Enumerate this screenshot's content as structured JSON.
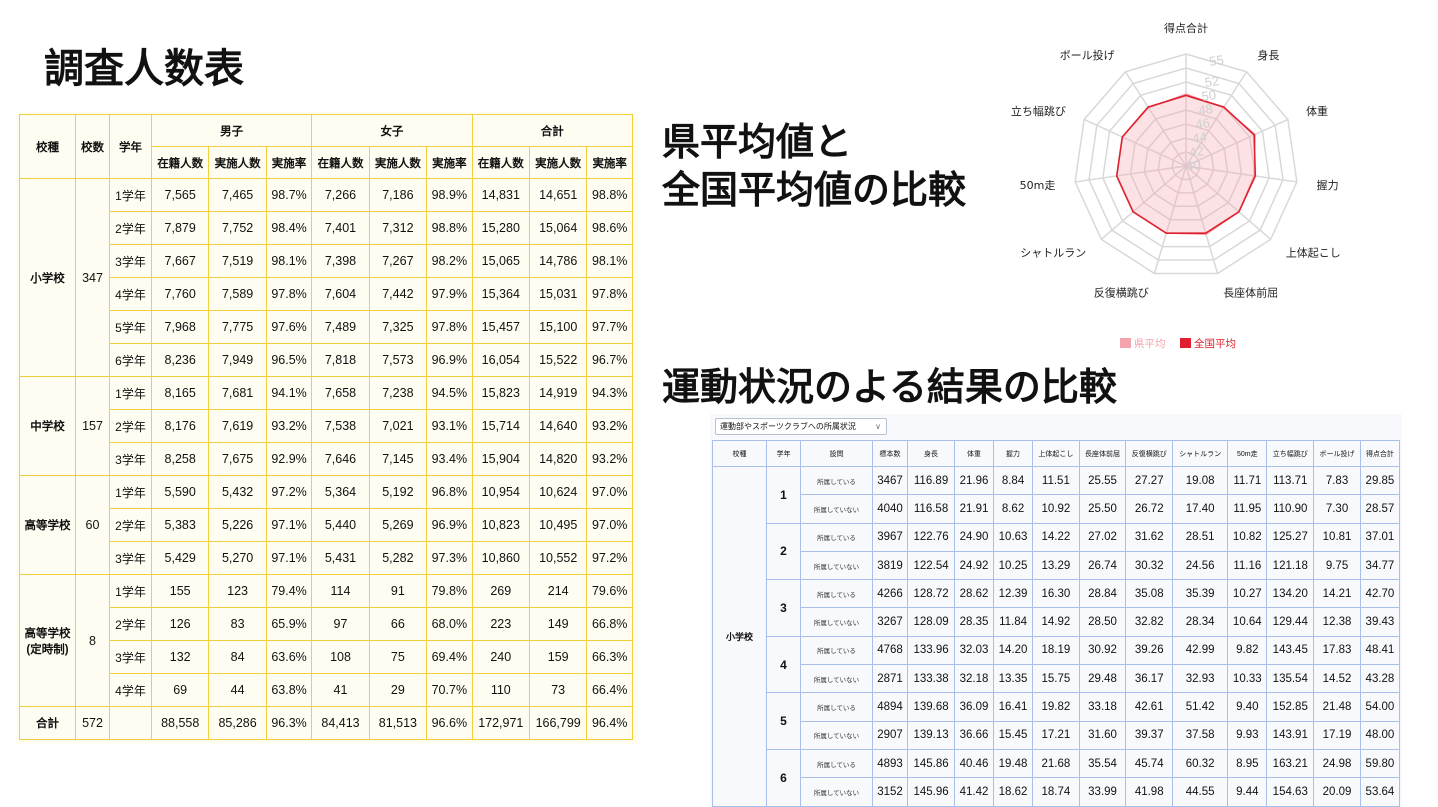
{
  "titles": {
    "main": "調査人数表",
    "compare_line1": "県平均値と",
    "compare_line2": "全国平均値の比較",
    "sports": "運動状況のよる結果の比較"
  },
  "survey": {
    "headers": {
      "school_type": "校種",
      "school_count": "校数",
      "grade": "学年",
      "male": "男子",
      "female": "女子",
      "total": "合計",
      "enrolled": "在籍人数",
      "conducted": "実施人数",
      "rate": "実施率"
    },
    "groups": [
      {
        "name": [
          "小学校"
        ],
        "count": "347",
        "rows": [
          [
            "1学年",
            "7,565",
            "7,465",
            "98.7%",
            "7,266",
            "7,186",
            "98.9%",
            "14,831",
            "14,651",
            "98.8%"
          ],
          [
            "2学年",
            "7,879",
            "7,752",
            "98.4%",
            "7,401",
            "7,312",
            "98.8%",
            "15,280",
            "15,064",
            "98.6%"
          ],
          [
            "3学年",
            "7,667",
            "7,519",
            "98.1%",
            "7,398",
            "7,267",
            "98.2%",
            "15,065",
            "14,786",
            "98.1%"
          ],
          [
            "4学年",
            "7,760",
            "7,589",
            "97.8%",
            "7,604",
            "7,442",
            "97.9%",
            "15,364",
            "15,031",
            "97.8%"
          ],
          [
            "5学年",
            "7,968",
            "7,775",
            "97.6%",
            "7,489",
            "7,325",
            "97.8%",
            "15,457",
            "15,100",
            "97.7%"
          ],
          [
            "6学年",
            "8,236",
            "7,949",
            "96.5%",
            "7,818",
            "7,573",
            "96.9%",
            "16,054",
            "15,522",
            "96.7%"
          ]
        ]
      },
      {
        "name": [
          "中学校"
        ],
        "count": "157",
        "rows": [
          [
            "1学年",
            "8,165",
            "7,681",
            "94.1%",
            "7,658",
            "7,238",
            "94.5%",
            "15,823",
            "14,919",
            "94.3%"
          ],
          [
            "2学年",
            "8,176",
            "7,619",
            "93.2%",
            "7,538",
            "7,021",
            "93.1%",
            "15,714",
            "14,640",
            "93.2%"
          ],
          [
            "3学年",
            "8,258",
            "7,675",
            "92.9%",
            "7,646",
            "7,145",
            "93.4%",
            "15,904",
            "14,820",
            "93.2%"
          ]
        ]
      },
      {
        "name": [
          "高等学校"
        ],
        "count": "60",
        "rows": [
          [
            "1学年",
            "5,590",
            "5,432",
            "97.2%",
            "5,364",
            "5,192",
            "96.8%",
            "10,954",
            "10,624",
            "97.0%"
          ],
          [
            "2学年",
            "5,383",
            "5,226",
            "97.1%",
            "5,440",
            "5,269",
            "96.9%",
            "10,823",
            "10,495",
            "97.0%"
          ],
          [
            "3学年",
            "5,429",
            "5,270",
            "97.1%",
            "5,431",
            "5,282",
            "97.3%",
            "10,860",
            "10,552",
            "97.2%"
          ]
        ]
      },
      {
        "name": [
          "高等学校",
          "(定時制)"
        ],
        "count": "8",
        "rows": [
          [
            "1学年",
            "155",
            "123",
            "79.4%",
            "114",
            "91",
            "79.8%",
            "269",
            "214",
            "79.6%"
          ],
          [
            "2学年",
            "126",
            "83",
            "65.9%",
            "97",
            "66",
            "68.0%",
            "223",
            "149",
            "66.8%"
          ],
          [
            "3学年",
            "132",
            "84",
            "63.6%",
            "108",
            "75",
            "69.4%",
            "240",
            "159",
            "66.3%"
          ],
          [
            "4学年",
            "69",
            "44",
            "63.8%",
            "41",
            "29",
            "70.7%",
            "110",
            "73",
            "66.4%"
          ]
        ]
      }
    ],
    "total_row": [
      "合計",
      "572",
      "",
      "88,558",
      "85,286",
      "96.3%",
      "84,413",
      "81,513",
      "96.6%",
      "172,971",
      "166,799",
      "96.4%"
    ]
  },
  "sports": {
    "select_label": "運動部やスポーツクラブへの所属状況",
    "headers": [
      "校種",
      "学年",
      "設問",
      "標本数",
      "身長",
      "体重",
      "握力",
      "上体起こし",
      "長座体前屈",
      "反復横跳び",
      "シャトルラン",
      "50m走",
      "立ち幅跳び",
      "ボール投げ",
      "得点合計"
    ],
    "school": "小学校",
    "grades": [
      {
        "grade": "1",
        "rows": [
          [
            "所属している",
            "3467",
            "116.89",
            "21.96",
            "8.84",
            "11.51",
            "25.55",
            "27.27",
            "19.08",
            "11.71",
            "113.71",
            "7.83",
            "29.85"
          ],
          [
            "所属していない",
            "4040",
            "116.58",
            "21.91",
            "8.62",
            "10.92",
            "25.50",
            "26.72",
            "17.40",
            "11.95",
            "110.90",
            "7.30",
            "28.57"
          ]
        ]
      },
      {
        "grade": "2",
        "rows": [
          [
            "所属している",
            "3967",
            "122.76",
            "24.90",
            "10.63",
            "14.22",
            "27.02",
            "31.62",
            "28.51",
            "10.82",
            "125.27",
            "10.81",
            "37.01"
          ],
          [
            "所属していない",
            "3819",
            "122.54",
            "24.92",
            "10.25",
            "13.29",
            "26.74",
            "30.32",
            "24.56",
            "11.16",
            "121.18",
            "9.75",
            "34.77"
          ]
        ]
      },
      {
        "grade": "3",
        "rows": [
          [
            "所属している",
            "4266",
            "128.72",
            "28.62",
            "12.39",
            "16.30",
            "28.84",
            "35.08",
            "35.39",
            "10.27",
            "134.20",
            "14.21",
            "42.70"
          ],
          [
            "所属していない",
            "3267",
            "128.09",
            "28.35",
            "11.84",
            "14.92",
            "28.50",
            "32.82",
            "28.34",
            "10.64",
            "129.44",
            "12.38",
            "39.43"
          ]
        ]
      },
      {
        "grade": "4",
        "rows": [
          [
            "所属している",
            "4768",
            "133.96",
            "32.03",
            "14.20",
            "18.19",
            "30.92",
            "39.26",
            "42.99",
            "9.82",
            "143.45",
            "17.83",
            "48.41"
          ],
          [
            "所属していない",
            "2871",
            "133.38",
            "32.18",
            "13.35",
            "15.75",
            "29.48",
            "36.17",
            "32.93",
            "10.33",
            "135.54",
            "14.52",
            "43.28"
          ]
        ]
      },
      {
        "grade": "5",
        "rows": [
          [
            "所属している",
            "4894",
            "139.68",
            "36.09",
            "16.41",
            "19.82",
            "33.18",
            "42.61",
            "51.42",
            "9.40",
            "152.85",
            "21.48",
            "54.00"
          ],
          [
            "所属していない",
            "2907",
            "139.13",
            "36.66",
            "15.45",
            "17.21",
            "31.60",
            "39.37",
            "37.58",
            "9.93",
            "143.91",
            "17.19",
            "48.00"
          ]
        ]
      },
      {
        "grade": "6",
        "rows": [
          [
            "所属している",
            "4893",
            "145.86",
            "40.46",
            "19.48",
            "21.68",
            "35.54",
            "45.74",
            "60.32",
            "8.95",
            "163.21",
            "24.98",
            "59.80"
          ],
          [
            "所属していない",
            "3152",
            "145.96",
            "41.42",
            "18.62",
            "18.74",
            "33.99",
            "41.98",
            "44.55",
            "9.44",
            "154.63",
            "20.09",
            "53.64"
          ]
        ]
      }
    ]
  },
  "chart_data": {
    "type": "radar",
    "axes": [
      "得点合計",
      "身長",
      "体重",
      "握力",
      "上体起こし",
      "長座体前屈",
      "反復横跳び",
      "シャトルラン",
      "50m走",
      "立ち幅跳び",
      "ボール投げ"
    ],
    "rmin": 40,
    "rmax": 56,
    "tick_labels": [
      "40",
      "42",
      "44",
      "46",
      "48",
      "50",
      "52",
      "55"
    ],
    "tick_values": [
      40,
      42,
      44,
      46,
      48,
      50,
      52,
      55
    ],
    "grid_levels": [
      40,
      42,
      44,
      46,
      48,
      50,
      52,
      54,
      56
    ],
    "series": [
      {
        "name": "県平均",
        "color": "#f5a3ad",
        "fill": "rgba(245,170,180,0.35)",
        "values": [
          50.3,
          49.9,
          50.9,
          49.8,
          50.0,
          50.2,
          50.0,
          50.0,
          50.0,
          50.0,
          49.9
        ]
      },
      {
        "name": "全国平均",
        "color": "#e0202e",
        "fill": "none",
        "values": [
          50.1,
          50.0,
          50.7,
          50.0,
          50.0,
          50.0,
          50.0,
          50.0,
          50.0,
          50.0,
          50.0
        ]
      }
    ],
    "legend": "bottom-center",
    "colors": {
      "grid": "#d8d8d8",
      "tick": "#cfcfcf"
    }
  }
}
